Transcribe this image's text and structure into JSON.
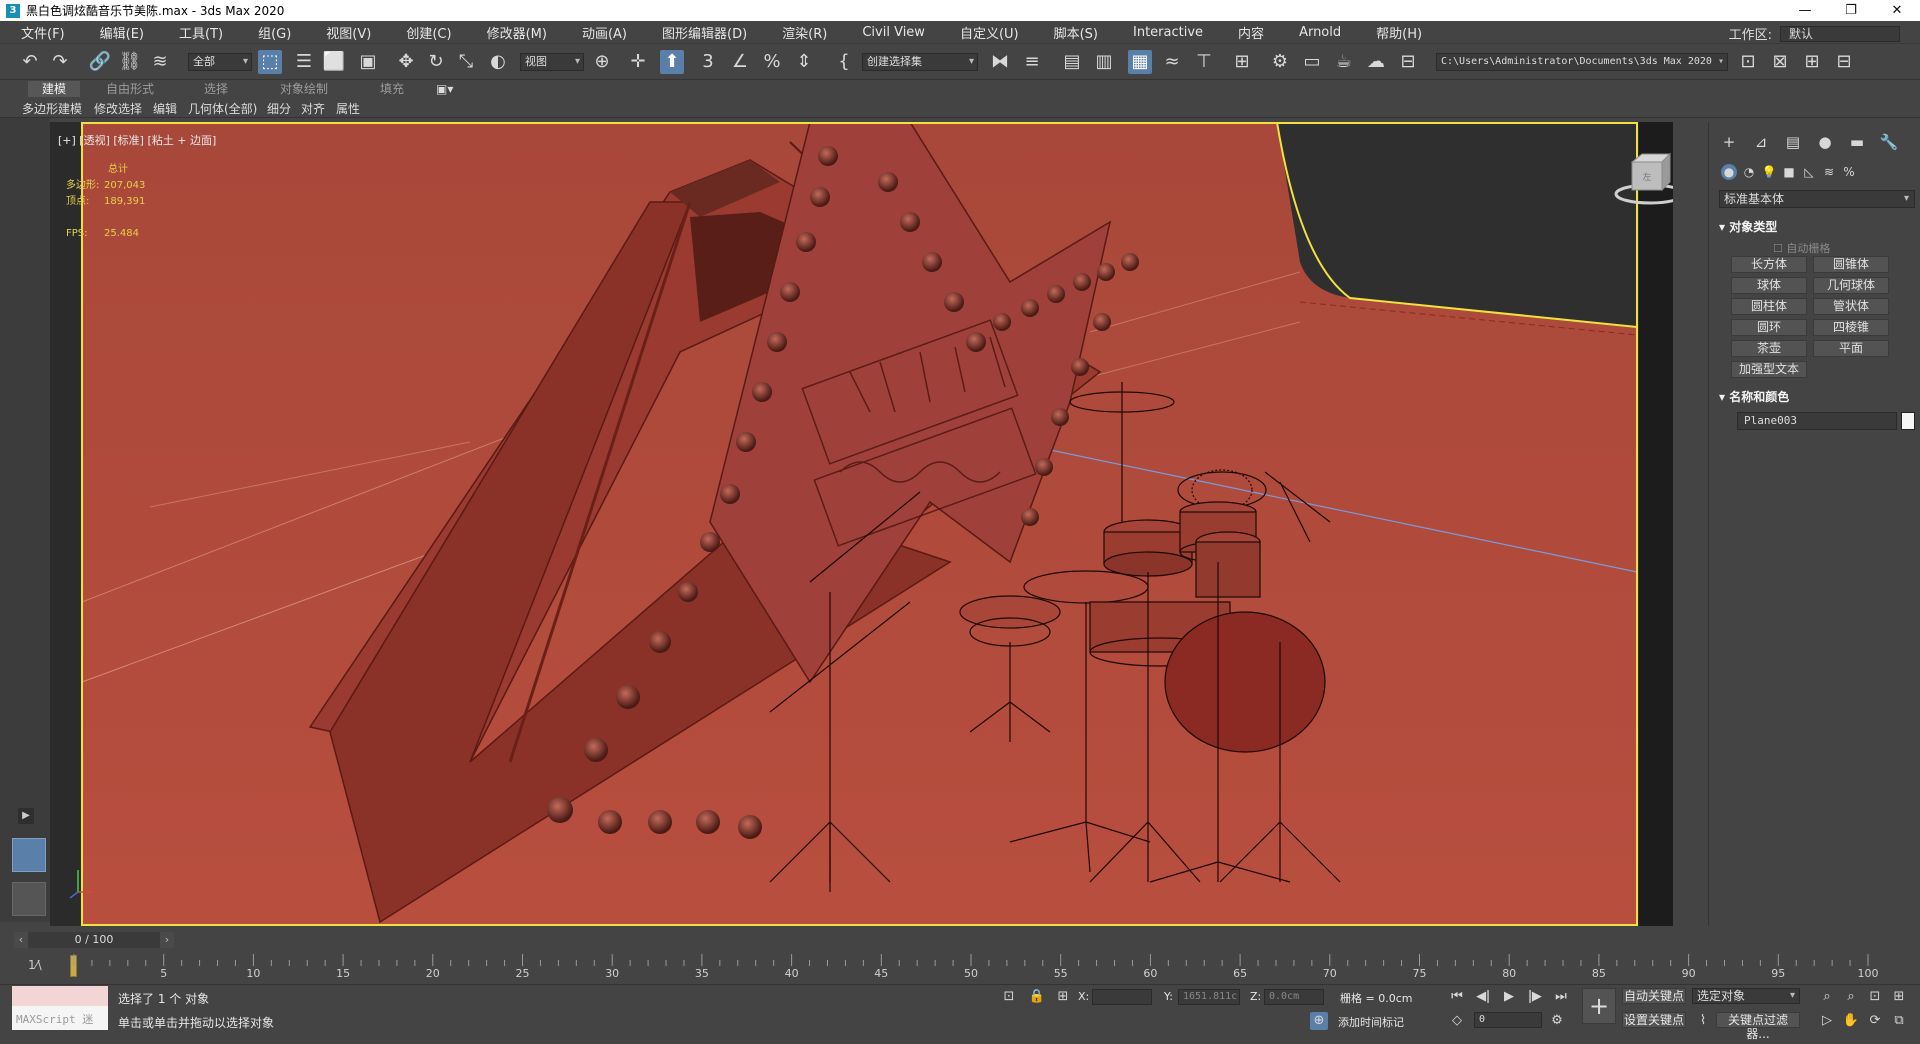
{
  "window": {
    "title": "黑白色调炫酷音乐节美陈.max - 3ds Max 2020",
    "app_icon": "3",
    "minimize": "—",
    "maximize": "❐",
    "close": "✕"
  },
  "menu": {
    "items": [
      "文件(F)",
      "编辑(E)",
      "工具(T)",
      "组(G)",
      "视图(V)",
      "创建(C)",
      "修改器(M)",
      "动画(A)",
      "图形编辑器(D)",
      "渲染(R)",
      "Civil View",
      "自定义(U)",
      "脚本(S)",
      "Interactive",
      "内容",
      "Arnold",
      "帮助(H)"
    ],
    "workspace_label": "工作区:",
    "workspace_value": "默认"
  },
  "toolbar": {
    "selection_filter": "全部",
    "ref_coord": "视图",
    "named_selection": "创建选择集",
    "project_path": "C:\\Users\\Administrator\\Documents\\3ds Max 2020"
  },
  "ribbon": {
    "tabs": [
      "建模",
      "自由形式",
      "选择",
      "对象绘制",
      "填充"
    ],
    "sub_items": [
      "多边形建模",
      "修改选择",
      "编辑",
      "几何体(全部)",
      "细分",
      "对齐",
      "属性"
    ]
  },
  "viewport": {
    "label": "[+] [透视] [标准] [粘土 + 边面]",
    "stats_title": "总计",
    "stats": [
      {
        "key": "多边形:",
        "value": "207,043"
      },
      {
        "key": "顶点:",
        "value": "189,391"
      }
    ],
    "fps_key": "FPS:",
    "fps_value": "25.484",
    "viewcube_label": "左",
    "floor_color": "#b04a3a",
    "selection_color": "#f0e040"
  },
  "command_panel": {
    "dropdown": "标准基本体",
    "section_object_type": "对象类型",
    "auto_grid": "自动栅格",
    "buttons": [
      "长方体",
      "圆锥体",
      "球体",
      "几何球体",
      "圆柱体",
      "管状体",
      "圆环",
      "四棱锥",
      "茶壶",
      "平面",
      "加强型文本"
    ],
    "section_name_color": "名称和颜色",
    "object_name": "Plane003"
  },
  "timeline": {
    "frame_display": "0 / 100",
    "ticks": [
      "0",
      "5",
      "10",
      "15",
      "20",
      "25",
      "30",
      "35",
      "40",
      "45",
      "50",
      "55",
      "60",
      "65",
      "70",
      "75",
      "80",
      "85",
      "90",
      "95",
      "100"
    ]
  },
  "status": {
    "maxscript": "MAXScript 迷",
    "selection_info": "选择了 1 个 对象",
    "prompt": "单击或单击并拖动以选择对象",
    "x_label": "X:",
    "x_value": "",
    "y_label": "Y:",
    "y_value": "1651.811c",
    "z_label": "Z:",
    "z_value": "0.0cm",
    "grid": "栅格 = 0.0cm",
    "add_time_tag": "添加时间标记",
    "auto_key": "自动关键点",
    "set_key": "设置关键点",
    "selected_object": "选定对象",
    "key_filter": "关键点过滤器...",
    "frame_value": "0"
  }
}
